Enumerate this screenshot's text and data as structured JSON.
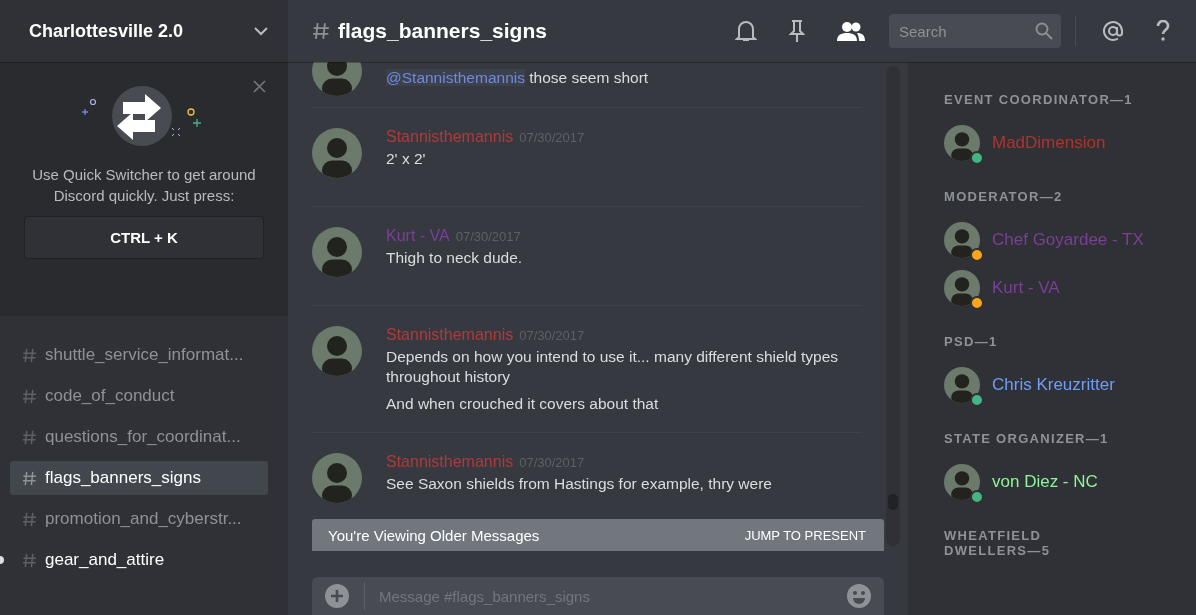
{
  "server": {
    "name": "Charlottesville 2.0"
  },
  "quick_switcher": {
    "text": "Use Quick Switcher to get around Discord quickly. Just press:",
    "shortcut": "CTRL + K"
  },
  "channels": [
    {
      "name": "shuttle_service_informat...",
      "selected": false,
      "unread": false
    },
    {
      "name": "code_of_conduct",
      "selected": false,
      "unread": false
    },
    {
      "name": "questions_for_coordinat...",
      "selected": false,
      "unread": false
    },
    {
      "name": "flags_banners_signs",
      "selected": true,
      "unread": false
    },
    {
      "name": "promotion_and_cyberstr...",
      "selected": false,
      "unread": false
    },
    {
      "name": "gear_and_attire",
      "selected": false,
      "unread": true
    }
  ],
  "channel": {
    "name": "flags_banners_signs"
  },
  "search": {
    "placeholder": "Search"
  },
  "messages": [
    {
      "kind": "continuation",
      "mention": "@Stannisthemannis",
      "lines": [
        "those seem short"
      ]
    },
    {
      "kind": "message",
      "author": "Stannisthemannis",
      "color": "#b03a3a",
      "time": "07/30/2017",
      "lines": [
        "2' x 2'"
      ]
    },
    {
      "kind": "message",
      "author": "Kurt - VA",
      "color": "#7b3f98",
      "time": "07/30/2017",
      "lines": [
        "Thigh to neck dude."
      ]
    },
    {
      "kind": "message",
      "author": "Stannisthemannis",
      "color": "#b03a3a",
      "time": "07/30/2017",
      "lines": [
        "Depends on how you intend to use it...  many different shield types throughout history",
        "And when crouched it covers about that"
      ]
    },
    {
      "kind": "message",
      "author": "Stannisthemannis",
      "color": "#b03a3a",
      "time": "07/30/2017",
      "lines": [
        "See Saxon shields from Hastings for example, thry were"
      ]
    }
  ],
  "older_banner": {
    "text": "You're Viewing Older Messages",
    "action": "JUMP TO PRESENT"
  },
  "composer": {
    "placeholder": "Message #flags_banners_signs"
  },
  "member_groups": [
    {
      "title": "EVENT COORDINATOR—1",
      "members": [
        {
          "name": "MadDimension",
          "color": "#b0332a",
          "idle": false
        }
      ]
    },
    {
      "title": "MODERATOR—2",
      "members": [
        {
          "name": "Chef Goyardee - TX",
          "color": "#7b3f98",
          "idle": true
        },
        {
          "name": "Kurt - VA",
          "color": "#7b3f98",
          "idle": true
        }
      ]
    },
    {
      "title": "PSD—1",
      "members": [
        {
          "name": "Chris Kreuzritter",
          "color": "#6f9ef8",
          "idle": false
        }
      ]
    },
    {
      "title": "STATE ORGANIZER—1",
      "members": [
        {
          "name": "von Diez - NC",
          "color": "#8ef59a",
          "idle": false
        }
      ]
    },
    {
      "title": "WHEATFIELD DWELLERS—5"
    }
  ]
}
